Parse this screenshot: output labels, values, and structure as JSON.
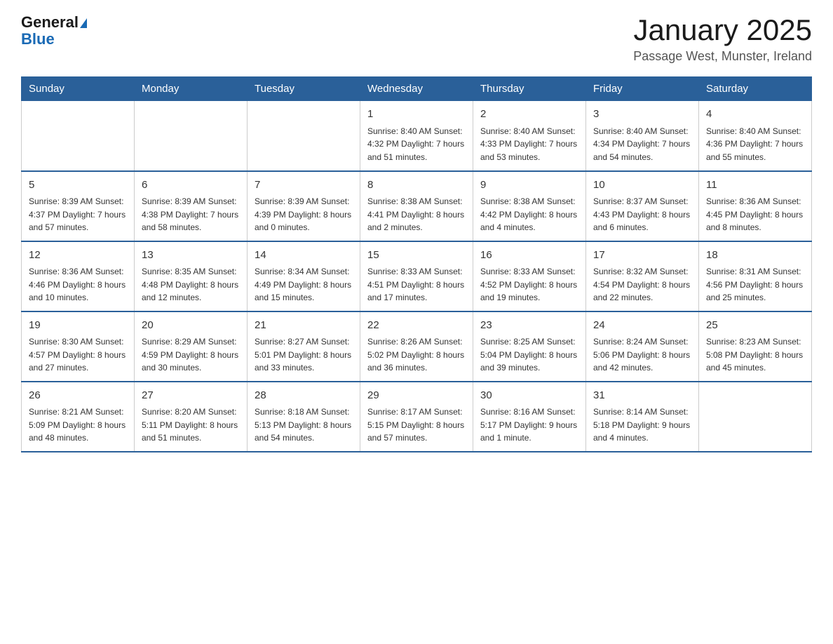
{
  "header": {
    "logo_general": "General",
    "logo_blue": "Blue",
    "title": "January 2025",
    "location": "Passage West, Munster, Ireland"
  },
  "days_of_week": [
    "Sunday",
    "Monday",
    "Tuesday",
    "Wednesday",
    "Thursday",
    "Friday",
    "Saturday"
  ],
  "weeks": [
    [
      {
        "day": "",
        "info": ""
      },
      {
        "day": "",
        "info": ""
      },
      {
        "day": "",
        "info": ""
      },
      {
        "day": "1",
        "info": "Sunrise: 8:40 AM\nSunset: 4:32 PM\nDaylight: 7 hours\nand 51 minutes."
      },
      {
        "day": "2",
        "info": "Sunrise: 8:40 AM\nSunset: 4:33 PM\nDaylight: 7 hours\nand 53 minutes."
      },
      {
        "day": "3",
        "info": "Sunrise: 8:40 AM\nSunset: 4:34 PM\nDaylight: 7 hours\nand 54 minutes."
      },
      {
        "day": "4",
        "info": "Sunrise: 8:40 AM\nSunset: 4:36 PM\nDaylight: 7 hours\nand 55 minutes."
      }
    ],
    [
      {
        "day": "5",
        "info": "Sunrise: 8:39 AM\nSunset: 4:37 PM\nDaylight: 7 hours\nand 57 minutes."
      },
      {
        "day": "6",
        "info": "Sunrise: 8:39 AM\nSunset: 4:38 PM\nDaylight: 7 hours\nand 58 minutes."
      },
      {
        "day": "7",
        "info": "Sunrise: 8:39 AM\nSunset: 4:39 PM\nDaylight: 8 hours\nand 0 minutes."
      },
      {
        "day": "8",
        "info": "Sunrise: 8:38 AM\nSunset: 4:41 PM\nDaylight: 8 hours\nand 2 minutes."
      },
      {
        "day": "9",
        "info": "Sunrise: 8:38 AM\nSunset: 4:42 PM\nDaylight: 8 hours\nand 4 minutes."
      },
      {
        "day": "10",
        "info": "Sunrise: 8:37 AM\nSunset: 4:43 PM\nDaylight: 8 hours\nand 6 minutes."
      },
      {
        "day": "11",
        "info": "Sunrise: 8:36 AM\nSunset: 4:45 PM\nDaylight: 8 hours\nand 8 minutes."
      }
    ],
    [
      {
        "day": "12",
        "info": "Sunrise: 8:36 AM\nSunset: 4:46 PM\nDaylight: 8 hours\nand 10 minutes."
      },
      {
        "day": "13",
        "info": "Sunrise: 8:35 AM\nSunset: 4:48 PM\nDaylight: 8 hours\nand 12 minutes."
      },
      {
        "day": "14",
        "info": "Sunrise: 8:34 AM\nSunset: 4:49 PM\nDaylight: 8 hours\nand 15 minutes."
      },
      {
        "day": "15",
        "info": "Sunrise: 8:33 AM\nSunset: 4:51 PM\nDaylight: 8 hours\nand 17 minutes."
      },
      {
        "day": "16",
        "info": "Sunrise: 8:33 AM\nSunset: 4:52 PM\nDaylight: 8 hours\nand 19 minutes."
      },
      {
        "day": "17",
        "info": "Sunrise: 8:32 AM\nSunset: 4:54 PM\nDaylight: 8 hours\nand 22 minutes."
      },
      {
        "day": "18",
        "info": "Sunrise: 8:31 AM\nSunset: 4:56 PM\nDaylight: 8 hours\nand 25 minutes."
      }
    ],
    [
      {
        "day": "19",
        "info": "Sunrise: 8:30 AM\nSunset: 4:57 PM\nDaylight: 8 hours\nand 27 minutes."
      },
      {
        "day": "20",
        "info": "Sunrise: 8:29 AM\nSunset: 4:59 PM\nDaylight: 8 hours\nand 30 minutes."
      },
      {
        "day": "21",
        "info": "Sunrise: 8:27 AM\nSunset: 5:01 PM\nDaylight: 8 hours\nand 33 minutes."
      },
      {
        "day": "22",
        "info": "Sunrise: 8:26 AM\nSunset: 5:02 PM\nDaylight: 8 hours\nand 36 minutes."
      },
      {
        "day": "23",
        "info": "Sunrise: 8:25 AM\nSunset: 5:04 PM\nDaylight: 8 hours\nand 39 minutes."
      },
      {
        "day": "24",
        "info": "Sunrise: 8:24 AM\nSunset: 5:06 PM\nDaylight: 8 hours\nand 42 minutes."
      },
      {
        "day": "25",
        "info": "Sunrise: 8:23 AM\nSunset: 5:08 PM\nDaylight: 8 hours\nand 45 minutes."
      }
    ],
    [
      {
        "day": "26",
        "info": "Sunrise: 8:21 AM\nSunset: 5:09 PM\nDaylight: 8 hours\nand 48 minutes."
      },
      {
        "day": "27",
        "info": "Sunrise: 8:20 AM\nSunset: 5:11 PM\nDaylight: 8 hours\nand 51 minutes."
      },
      {
        "day": "28",
        "info": "Sunrise: 8:18 AM\nSunset: 5:13 PM\nDaylight: 8 hours\nand 54 minutes."
      },
      {
        "day": "29",
        "info": "Sunrise: 8:17 AM\nSunset: 5:15 PM\nDaylight: 8 hours\nand 57 minutes."
      },
      {
        "day": "30",
        "info": "Sunrise: 8:16 AM\nSunset: 5:17 PM\nDaylight: 9 hours\nand 1 minute."
      },
      {
        "day": "31",
        "info": "Sunrise: 8:14 AM\nSunset: 5:18 PM\nDaylight: 9 hours\nand 4 minutes."
      },
      {
        "day": "",
        "info": ""
      }
    ]
  ]
}
